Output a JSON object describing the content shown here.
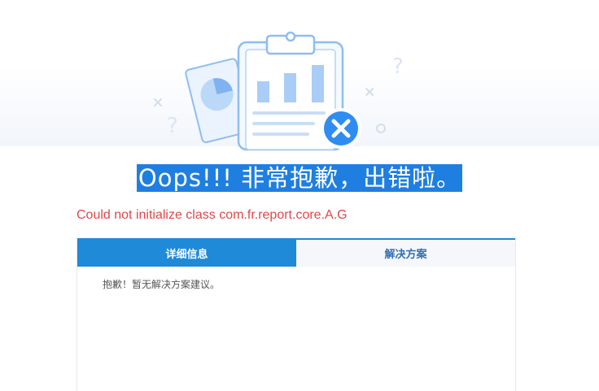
{
  "error_page": {
    "title": "Oops!!! 非常抱歉，出错啦。",
    "error_message": "Could not initialize class com.fr.report.core.A.G",
    "tabs": [
      {
        "label": "详细信息",
        "active": true
      },
      {
        "label": "解决方案",
        "active": false
      }
    ],
    "panel_text": "抱歉！暂无解决方案建议。"
  },
  "colors": {
    "accent": "#1e8ad8",
    "title_highlight": "#1e7fe0",
    "error_text": "#e0474b",
    "icon_badge": "#2f8cf0"
  },
  "icons": [
    "clipboard-icon",
    "pie-chart-card-icon",
    "bar-chart-icon",
    "close-badge-icon",
    "question-mark-icon",
    "cross-mark-icon",
    "circle-dot-icon"
  ]
}
